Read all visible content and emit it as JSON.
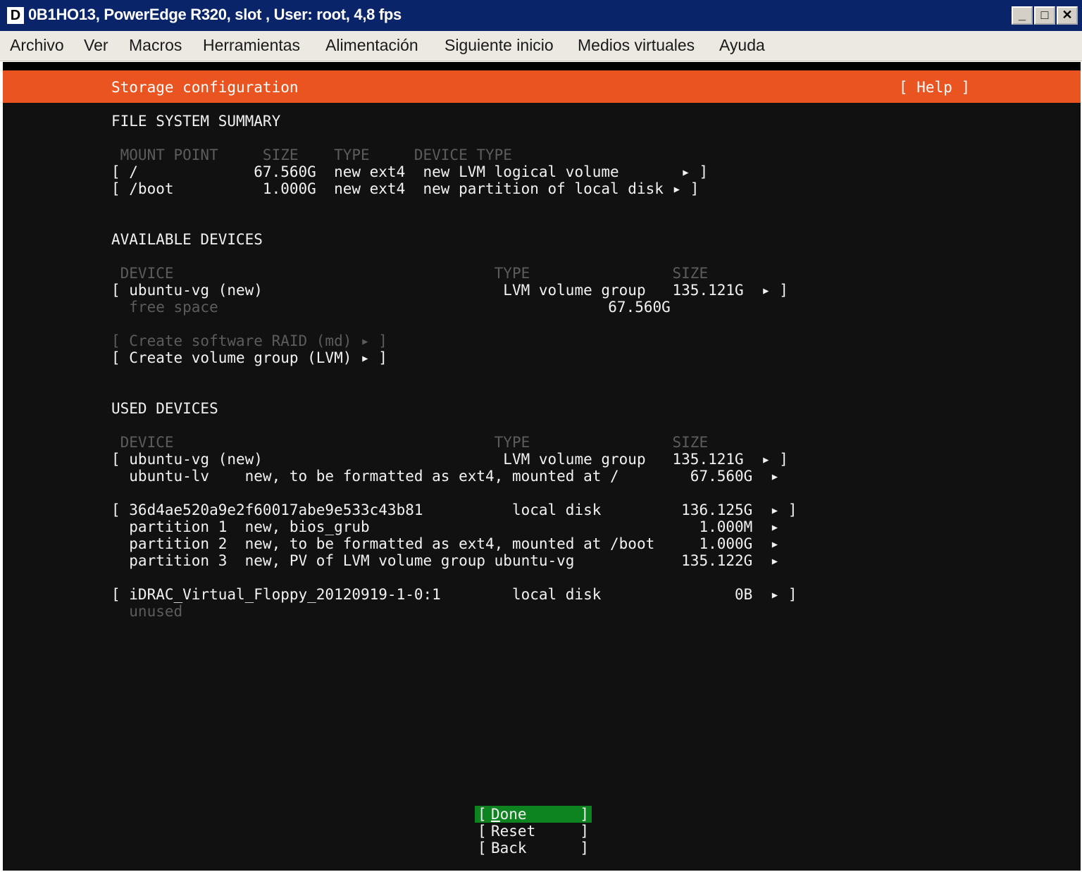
{
  "window": {
    "icon": "D",
    "title": "0B1HO13, PowerEdge R320,  slot , User: root, 4,8 fps",
    "controls": [
      "minimize-icon",
      "maximize-icon",
      "close-icon"
    ]
  },
  "menu": [
    "Archivo",
    "Ver",
    "Macros",
    "Herramientas",
    "Alimentación",
    "Siguiente inicio",
    "Medios virtuales",
    "Ayuda"
  ],
  "screen": {
    "title": "Storage configuration",
    "help": "[ Help ]",
    "accent_color": "#e95420",
    "lines": {
      "fs_title": "FILE SYSTEM SUMMARY",
      "fs_header": " MOUNT POINT     SIZE    TYPE     DEVICE TYPE",
      "fs_row1": "[ /             67.560G  new ext4  new LVM logical volume       ▸ ]",
      "fs_row2": "[ /boot          1.000G  new ext4  new partition of local disk ▸ ]",
      "avail_title": "AVAILABLE DEVICES",
      "avail_header": " DEVICE                                    TYPE                SIZE",
      "avail_row1": "[ ubuntu-vg (new)                           LVM volume group   135.121G  ▸ ]",
      "avail_row2": "  free space                                                    67.560G",
      "action_raid": "[ Create software RAID (md) ▸ ]",
      "action_lvm": "[ Create volume group (LVM) ▸ ]",
      "used_title": "USED DEVICES",
      "used_header": " DEVICE                                    TYPE                SIZE",
      "used_row1": "[ ubuntu-vg (new)                           LVM volume group   135.121G  ▸ ]",
      "used_row2": "  ubuntu-lv    new, to be formatted as ext4, mounted at /        67.560G  ▸",
      "used_row3": "[ 36d4ae520a9e2f60017abe9e533c43b81          local disk         136.125G  ▸ ]",
      "used_row4": "  partition 1  new, bios_grub                                     1.000M  ▸",
      "used_row5": "  partition 2  new, to be formatted as ext4, mounted at /boot     1.000G  ▸",
      "used_row6": "  partition 3  new, PV of LVM volume group ubuntu-vg            135.122G  ▸",
      "used_row7": "[ iDRAC_Virtual_Floppy_20120919-1-0:1        local disk               0B  ▸ ]",
      "used_row8": "  unused"
    },
    "buttons": [
      "Done",
      "Reset",
      "Back"
    ],
    "selected_button": "Done",
    "selected_color": "#0e8420"
  }
}
